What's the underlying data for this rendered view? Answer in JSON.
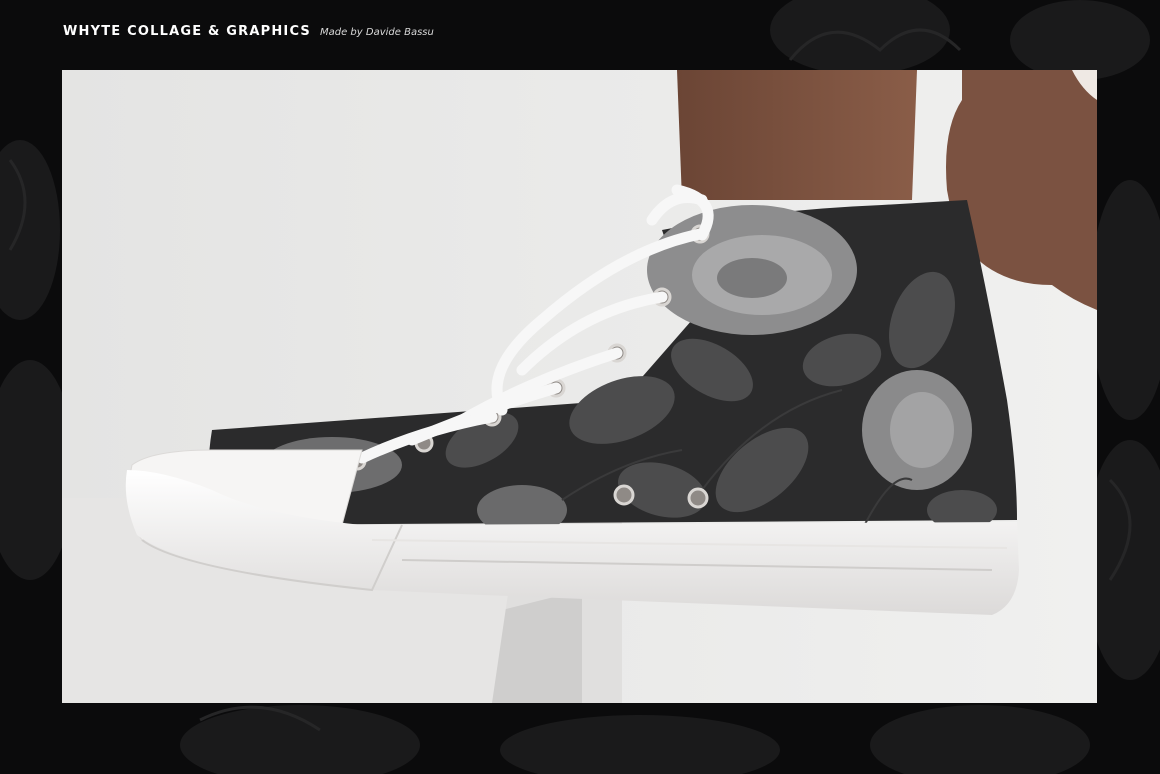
{
  "header": {
    "brand": "WHYTE COLLAGE & GRAPHICS",
    "credit": "Made by Davide Bassu"
  },
  "photo": {
    "subject": "high-top-sneaker-with-black-and-white-rose-print",
    "colors": {
      "page_background": "#0b0b0c",
      "backdrop": "#e9e9e8",
      "shoe_canvas": "#2b2b2c",
      "sole": "#f4f3f2",
      "skin": "#7a5240"
    }
  }
}
